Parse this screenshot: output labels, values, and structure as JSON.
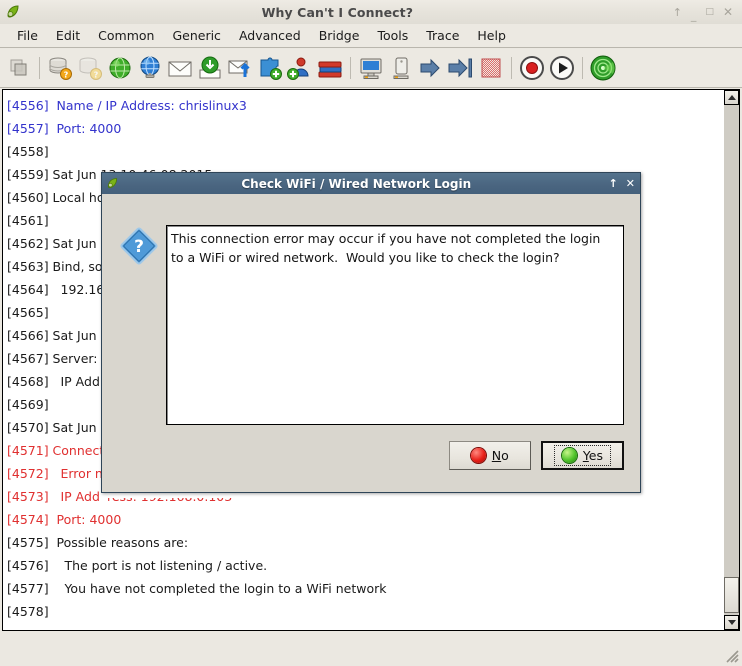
{
  "window": {
    "title": "Why Can't I Connect?",
    "icon": "app-leaf-icon",
    "buttons": {
      "rollup": "↑",
      "minimize": "_",
      "maximize": "□",
      "close": "✕"
    }
  },
  "menu": {
    "items": [
      {
        "label": "File"
      },
      {
        "label": "Edit"
      },
      {
        "label": "Common"
      },
      {
        "label": "Generic"
      },
      {
        "label": "Advanced"
      },
      {
        "label": "Bridge"
      },
      {
        "label": "Tools"
      },
      {
        "label": "Trace"
      },
      {
        "label": "Help"
      }
    ]
  },
  "toolbar": {
    "items": [
      {
        "name": "copy-icon"
      },
      {
        "name": "separator"
      },
      {
        "name": "database-query-icon"
      },
      {
        "name": "database-query-disabled-icon"
      },
      {
        "name": "globe-green-icon"
      },
      {
        "name": "globe-blue-icon"
      },
      {
        "name": "mail-icon"
      },
      {
        "name": "download-icon"
      },
      {
        "name": "mail-send-icon"
      },
      {
        "name": "puzzle-add-icon"
      },
      {
        "name": "user-add-icon"
      },
      {
        "name": "books-icon"
      },
      {
        "name": "separator"
      },
      {
        "name": "monitor-icon"
      },
      {
        "name": "server-icon"
      },
      {
        "name": "arrow-right-icon"
      },
      {
        "name": "arrow-right-end-icon"
      },
      {
        "name": "stop-icon"
      },
      {
        "name": "separator"
      },
      {
        "name": "record-icon"
      },
      {
        "name": "play-icon"
      },
      {
        "name": "separator"
      },
      {
        "name": "radar-icon"
      }
    ]
  },
  "log": {
    "lines": [
      {
        "num": "[4556]",
        "text": "  Name / IP Address: chrislinux3",
        "color": "blue"
      },
      {
        "num": "[4557]",
        "text": "  Port: 4000",
        "color": "blue"
      },
      {
        "num": "[4558]",
        "text": "",
        "color": "black"
      },
      {
        "num": "[4559]",
        "text": " Sat Jun 13 10:46:08 2015",
        "color": "black"
      },
      {
        "num": "[4560]",
        "text": " Local ho",
        "color": "black"
      },
      {
        "num": "[4561]",
        "text": "",
        "color": "black"
      },
      {
        "num": "[4562]",
        "text": " Sat Jun",
        "color": "black"
      },
      {
        "num": "[4563]",
        "text": " Bind, so",
        "color": "black"
      },
      {
        "num": "[4564]",
        "text": "   192.16",
        "color": "black"
      },
      {
        "num": "[4565]",
        "text": "",
        "color": "black"
      },
      {
        "num": "[4566]",
        "text": " Sat Jun",
        "color": "black"
      },
      {
        "num": "[4567]",
        "text": " Server:",
        "color": "black"
      },
      {
        "num": "[4568]",
        "text": "   IP Add",
        "color": "black"
      },
      {
        "num": "[4569]",
        "text": "",
        "color": "black"
      },
      {
        "num": "[4570]",
        "text": " Sat Jun",
        "color": "black"
      },
      {
        "num": "[4571]",
        "text": " Connect",
        "color": "red"
      },
      {
        "num": "[4572]",
        "text": "   Error n",
        "color": "red"
      },
      {
        "num": "[4573]",
        "text": "   IP Add",
        "color": "red"
      },
      {
        "num": "[4574]",
        "text": "  Port: 4000",
        "color": "red"
      },
      {
        "num": "[4575]",
        "text": "  Possible reasons are:",
        "color": "black"
      },
      {
        "num": "[4576]",
        "text": "    The port is not listening / active.",
        "color": "black"
      },
      {
        "num": "[4577]",
        "text": "    You have not completed the login to a WiFi network",
        "color": "black"
      },
      {
        "num": "[4578]",
        "text": "",
        "color": "black"
      }
    ],
    "clipped_line_remainder": "ress: 192.168.0.103"
  },
  "dialog": {
    "title": "Check WiFi / Wired Network Login",
    "icon": "question-mark-icon",
    "title_icon": "app-leaf-icon",
    "titlebar_buttons": {
      "rollup": "↑",
      "close": "✕"
    },
    "message": "This connection error may occur if you have not completed the login\nto a WiFi or wired network.  Would you like to check the login?",
    "buttons": [
      {
        "name": "no-button",
        "label_pre": "",
        "accel": "N",
        "label_post": "o",
        "led": "red",
        "focused": false
      },
      {
        "name": "yes-button",
        "label_pre": "",
        "accel": "Y",
        "label_post": "es",
        "led": "green",
        "focused": true
      }
    ]
  },
  "colors": {
    "window_bg": "#ece9e2",
    "dialog_titlebar": "#4a6580",
    "log_blue": "#3333cc",
    "log_red": "#e03030",
    "led_red": "#e81f18",
    "led_green": "#4fc32a"
  }
}
